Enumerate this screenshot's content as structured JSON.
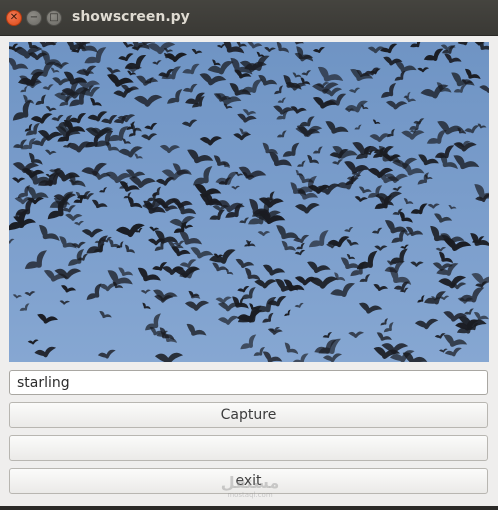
{
  "window": {
    "title": "showscreen.py",
    "controls": {
      "close_icon": "close-icon",
      "minimize_icon": "minimize-icon",
      "maximize_icon": "maximize-icon"
    }
  },
  "video_frame": {
    "subject": "flock of starlings in flight against blue sky",
    "sky_color": "#7a9dcb",
    "bird_color": "#1a1c22"
  },
  "label_field": {
    "value": "starling"
  },
  "buttons": {
    "capture": "Capture",
    "blank": "",
    "exit": "exit"
  },
  "watermark": {
    "logo": "مستقل",
    "sub": "mostaql.com"
  }
}
